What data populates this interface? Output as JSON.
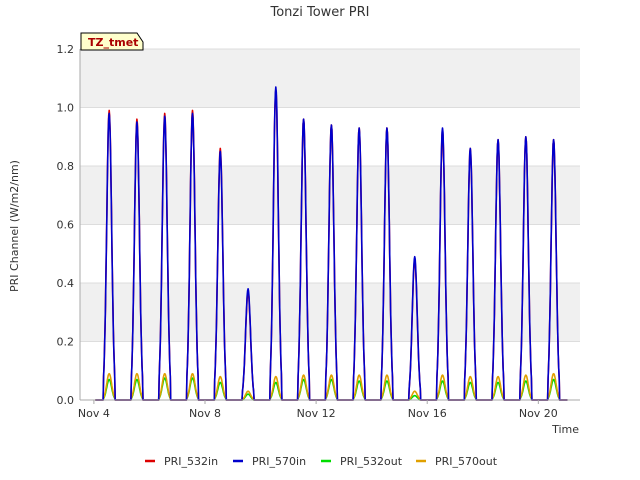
{
  "chart_data": {
    "type": "line",
    "title": "Tonzi Tower PRI",
    "xlabel": "Time",
    "ylabel": "PRI Channel (W/m2/nm)",
    "tag": "TZ_tmet",
    "xlim": [
      3.5,
      21.5
    ],
    "ylim": [
      0.0,
      1.2
    ],
    "x_ticks": [
      {
        "value": 4,
        "label": "Nov 4"
      },
      {
        "value": 8,
        "label": "Nov 8"
      },
      {
        "value": 12,
        "label": "Nov 12"
      },
      {
        "value": 16,
        "label": "Nov 16"
      },
      {
        "value": 20,
        "label": "Nov 20"
      }
    ],
    "y_ticks": [
      {
        "value": 0.0,
        "label": "0.0"
      },
      {
        "value": 0.2,
        "label": "0.2"
      },
      {
        "value": 0.4,
        "label": "0.4"
      },
      {
        "value": 0.6,
        "label": "0.6"
      },
      {
        "value": 0.8,
        "label": "0.8"
      },
      {
        "value": 1.0,
        "label": "1.0"
      },
      {
        "value": 1.2,
        "label": "1.2"
      }
    ],
    "grid": true,
    "legend_position": "bottom",
    "days": [
      4.55,
      5.55,
      6.55,
      7.55,
      8.55,
      9.55,
      10.55,
      11.55,
      12.55,
      13.55,
      14.55,
      15.55,
      16.55,
      17.55,
      18.55,
      19.55,
      20.55
    ],
    "series": [
      {
        "name": "PRI_532in",
        "color": "#dd0000",
        "peaks": [
          0.99,
          0.96,
          0.98,
          0.99,
          0.86,
          0.37,
          1.06,
          0.96,
          0.94,
          0.93,
          0.93,
          0.48,
          0.92,
          0.86,
          0.89,
          0.9,
          0.89
        ]
      },
      {
        "name": "PRI_570in",
        "color": "#0000cc",
        "peaks": [
          0.98,
          0.95,
          0.97,
          0.98,
          0.85,
          0.38,
          1.07,
          0.96,
          0.94,
          0.93,
          0.93,
          0.49,
          0.93,
          0.86,
          0.89,
          0.9,
          0.89
        ]
      },
      {
        "name": "PRI_532out",
        "color": "#00dd00",
        "peaks": [
          0.07,
          0.07,
          0.075,
          0.075,
          0.06,
          0.02,
          0.06,
          0.07,
          0.07,
          0.065,
          0.065,
          0.015,
          0.065,
          0.06,
          0.06,
          0.065,
          0.07
        ]
      },
      {
        "name": "PRI_570out",
        "color": "#e0a000",
        "peaks": [
          0.09,
          0.09,
          0.09,
          0.09,
          0.08,
          0.03,
          0.08,
          0.085,
          0.085,
          0.085,
          0.085,
          0.03,
          0.085,
          0.08,
          0.08,
          0.085,
          0.09
        ]
      }
    ]
  }
}
